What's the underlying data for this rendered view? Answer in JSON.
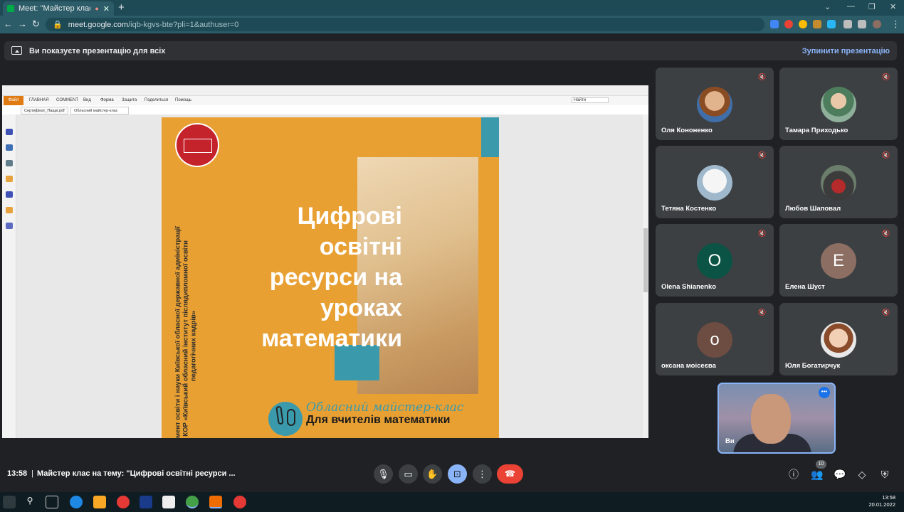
{
  "browser": {
    "tab_title": "Meet: \"Майстер клас на тем",
    "url_domain": "meet.google.com",
    "url_path": "/iqb-kgvs-bte?pli=1&authuser=0"
  },
  "banner": {
    "presenting_text": "Ви показуєте презентацію для всіх",
    "stop_label": "Зупинити презентацію"
  },
  "pdf": {
    "ribbon": [
      "ГЛАВНАЯ",
      "COMMENT",
      "Вид",
      "Форма",
      "Защита",
      "Поделиться",
      "Помощь"
    ],
    "file_tab": "Файл",
    "tabs": [
      "Сертифікат_Пащкі.pdf",
      "Обласний майстер-клас"
    ],
    "search_placeholder": "Найти"
  },
  "slide": {
    "title": "Цифрові освітні ресурси на уроках математики",
    "vertical_line1": "Департамент освіти і науки Київської обласної державної адміністрації",
    "vertical_line2": "КНЗ КОР «Київський обласний інститут післядипломної освіти",
    "vertical_line3": "педагогічних кадрів»",
    "subtitle1": "Обласний майстер-клас",
    "subtitle2": "Для вчителів математики"
  },
  "participants": [
    {
      "name": "Оля Кононенко",
      "avatar": "photo"
    },
    {
      "name": "Тамара Приходько",
      "avatar": "photo"
    },
    {
      "name": "Тетяна Костенко",
      "avatar": "photo"
    },
    {
      "name": "Любов Шаповал",
      "avatar": "photo"
    },
    {
      "name": "Olena Shianenko",
      "avatar": "O",
      "color": "#0b5345"
    },
    {
      "name": "Елена Шуст",
      "avatar": "Е",
      "color": "#8d6e63"
    },
    {
      "name": "оксана моісеєва",
      "avatar": "о",
      "color": "#6d4c41"
    },
    {
      "name": "Юля Богатирчук",
      "avatar": "photo"
    }
  ],
  "self": {
    "label": "Ви"
  },
  "bottom": {
    "time": "13:58",
    "separator": "|",
    "meeting_title": "Майстер клас на тему: \"Цифрові освітні ресурси ...",
    "participant_count": "10"
  },
  "taskbar": {
    "time": "13:58",
    "date": "20.01.2022"
  }
}
